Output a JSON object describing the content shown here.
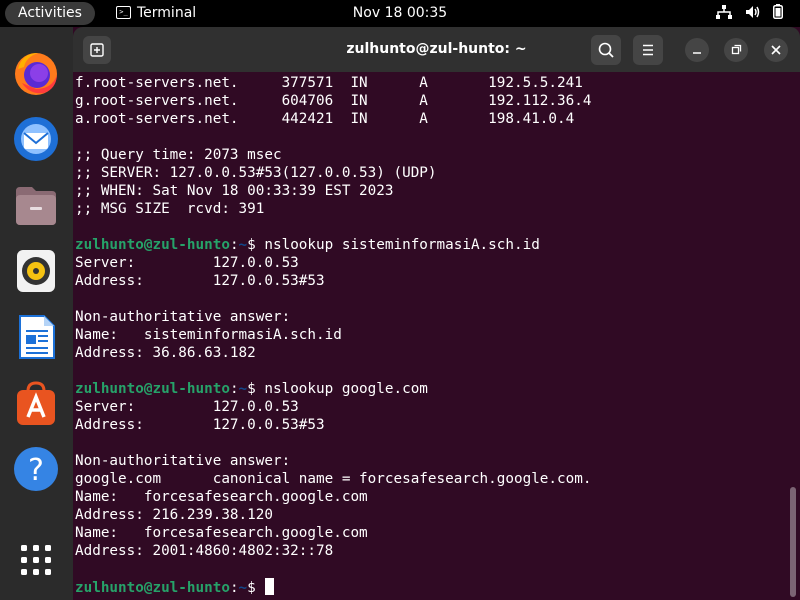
{
  "topbar": {
    "activities": "Activities",
    "app_name": "Terminal",
    "clock": "Nov 18  00:35",
    "icons": [
      "network-icon",
      "volume-icon",
      "battery-icon"
    ]
  },
  "dock": {
    "apps": [
      "Firefox",
      "Thunderbird",
      "Files",
      "Rhythmbox",
      "LibreOffice Writer",
      "Ubuntu Software",
      "Help",
      "Show Applications"
    ]
  },
  "window": {
    "title": "zulhunto@zul-hunto: ~",
    "buttons": [
      "new-tab",
      "search",
      "menu",
      "minimize",
      "maximize",
      "close"
    ]
  },
  "terminal": {
    "prompt": {
      "user_host": "zulhunto@zul-hunto",
      "sep": ":",
      "path": "~",
      "dollar": "$ "
    },
    "lines": [
      {
        "type": "text",
        "text": "f.root-servers.net.     377571  IN      A       192.5.5.241"
      },
      {
        "type": "text",
        "text": "g.root-servers.net.     604706  IN      A       192.112.36.4"
      },
      {
        "type": "text",
        "text": "a.root-servers.net.     442421  IN      A       198.41.0.4"
      },
      {
        "type": "text",
        "text": ""
      },
      {
        "type": "text",
        "text": ";; Query time: 2073 msec"
      },
      {
        "type": "text",
        "text": ";; SERVER: 127.0.0.53#53(127.0.0.53) (UDP)"
      },
      {
        "type": "text",
        "text": ";; WHEN: Sat Nov 18 00:33:39 EST 2023"
      },
      {
        "type": "text",
        "text": ";; MSG SIZE  rcvd: 391"
      },
      {
        "type": "text",
        "text": ""
      },
      {
        "type": "prompt",
        "cmd": "nslookup sisteminformasiA.sch.id"
      },
      {
        "type": "text",
        "text": "Server:         127.0.0.53"
      },
      {
        "type": "text",
        "text": "Address:        127.0.0.53#53"
      },
      {
        "type": "text",
        "text": ""
      },
      {
        "type": "text",
        "text": "Non-authoritative answer:"
      },
      {
        "type": "text",
        "text": "Name:   sisteminformasiA.sch.id"
      },
      {
        "type": "text",
        "text": "Address: 36.86.63.182"
      },
      {
        "type": "text",
        "text": ""
      },
      {
        "type": "prompt",
        "cmd": "nslookup google.com"
      },
      {
        "type": "text",
        "text": "Server:         127.0.0.53"
      },
      {
        "type": "text",
        "text": "Address:        127.0.0.53#53"
      },
      {
        "type": "text",
        "text": ""
      },
      {
        "type": "text",
        "text": "Non-authoritative answer:"
      },
      {
        "type": "text",
        "text": "google.com      canonical name = forcesafesearch.google.com."
      },
      {
        "type": "text",
        "text": "Name:   forcesafesearch.google.com"
      },
      {
        "type": "text",
        "text": "Address: 216.239.38.120"
      },
      {
        "type": "text",
        "text": "Name:   forcesafesearch.google.com"
      },
      {
        "type": "text",
        "text": "Address: 2001:4860:4802:32::78"
      },
      {
        "type": "text",
        "text": ""
      },
      {
        "type": "prompt",
        "cmd": "",
        "cursor": true
      }
    ]
  }
}
